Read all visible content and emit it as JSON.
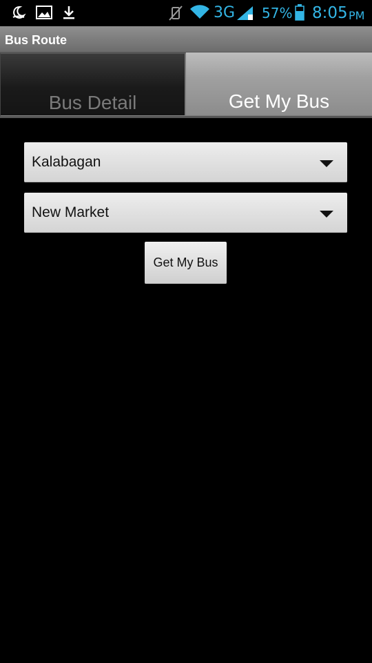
{
  "status_bar": {
    "icons_left": [
      "moon-icon",
      "image-icon",
      "download-icon"
    ],
    "icons_right": [
      "vibrate-off-icon",
      "wifi-icon",
      "signal-icon",
      "battery-icon"
    ],
    "network": "3G",
    "battery": "57%",
    "time": "8:05",
    "ampm": "PM",
    "accent_color": "#33b5e5"
  },
  "app": {
    "title": "Bus Route"
  },
  "tabs": [
    {
      "label": "Bus Detail",
      "selected": false
    },
    {
      "label": "Get My Bus",
      "selected": true
    }
  ],
  "form": {
    "from_value": "Kalabagan",
    "to_value": "New Market",
    "submit_label": "Get My Bus"
  }
}
